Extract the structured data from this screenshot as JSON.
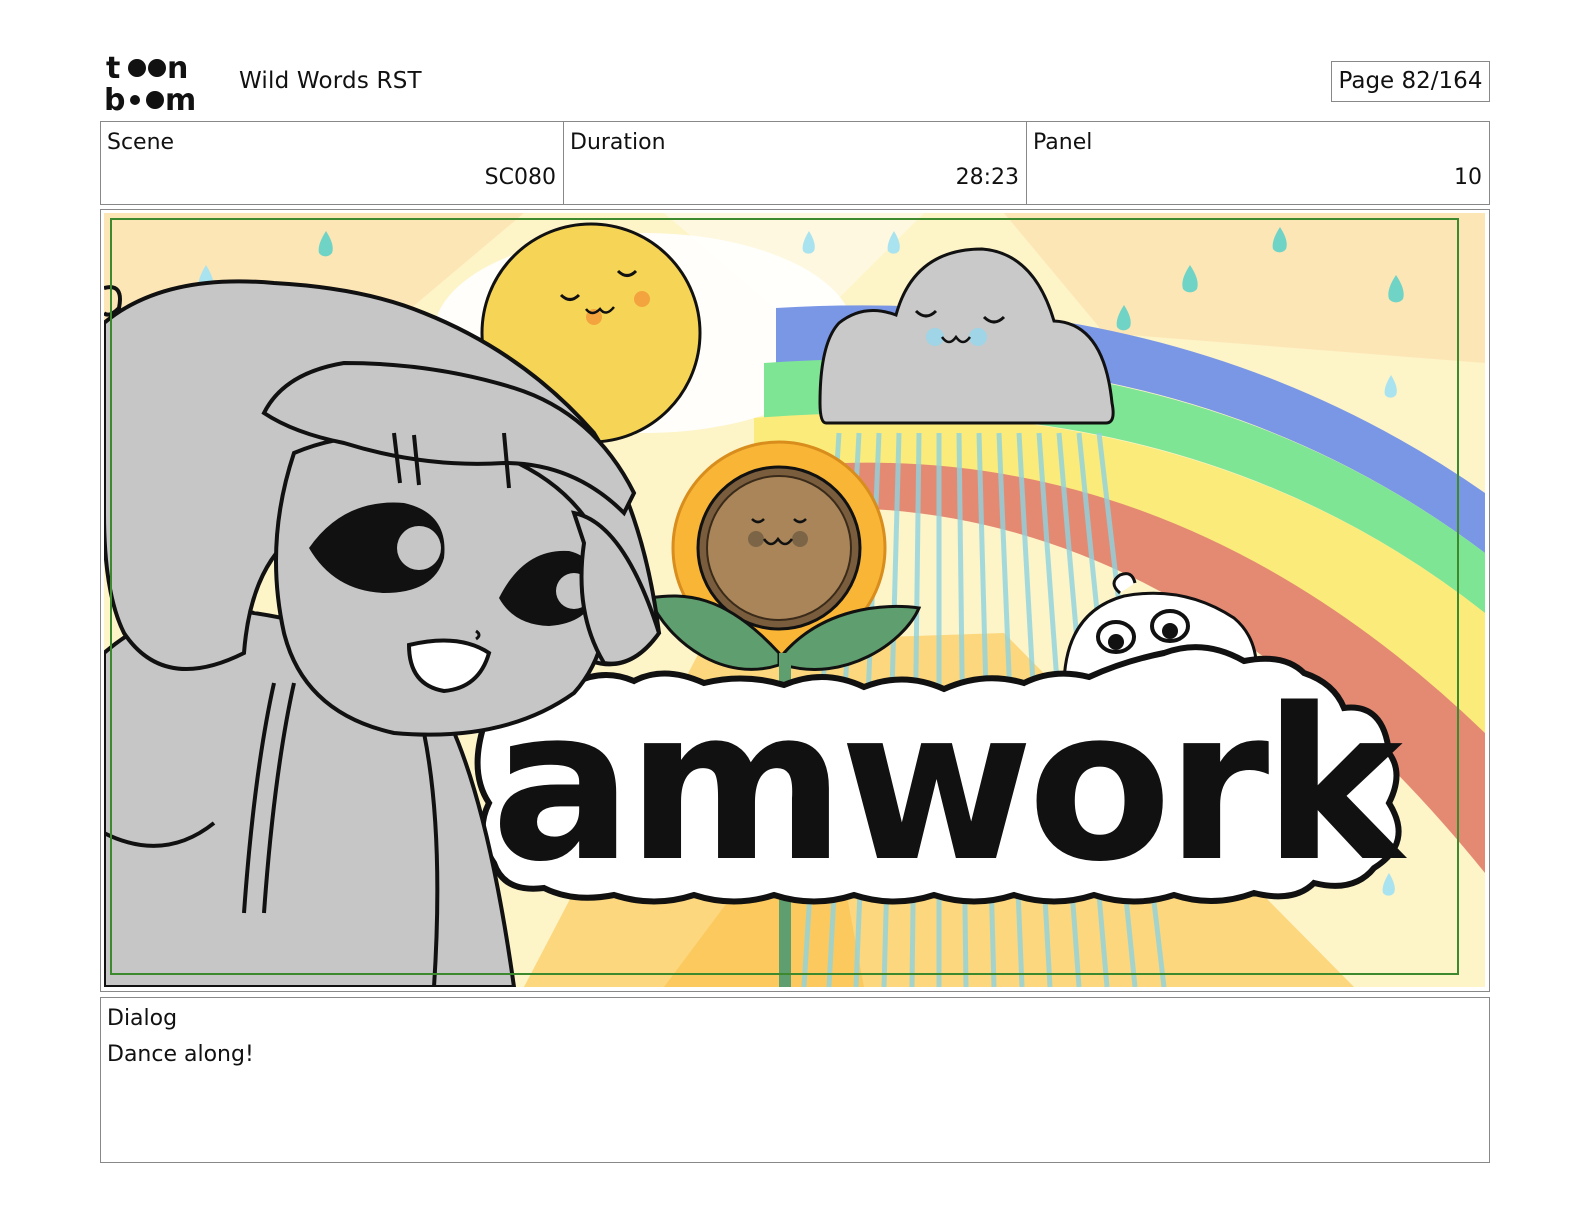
{
  "header": {
    "logo_text": "toon boom",
    "document_title": "Wild Words RST",
    "page_label": "Page",
    "page_value": "82/164"
  },
  "info": {
    "scene_label": "Scene",
    "scene_value": "SC080",
    "duration_label": "Duration",
    "duration_value": "28:23",
    "panel_label": "Panel",
    "panel_value": "10"
  },
  "panel_image": {
    "banner_text": "amwork"
  },
  "dialog": {
    "label": "Dialog",
    "text": "Dance along!"
  },
  "colors": {
    "border": "#888888",
    "safe_frame": "#3d8a2e",
    "sky": "#fdf4c8",
    "sun": "#f6d556",
    "rainbow_blue": "#7a97e6",
    "rainbow_green": "#7ee594",
    "rainbow_yellow": "#fbeb7a",
    "rainbow_red": "#e48a73",
    "raindrop": "#6fd3c6",
    "character_gray": "#c6c6c6"
  }
}
